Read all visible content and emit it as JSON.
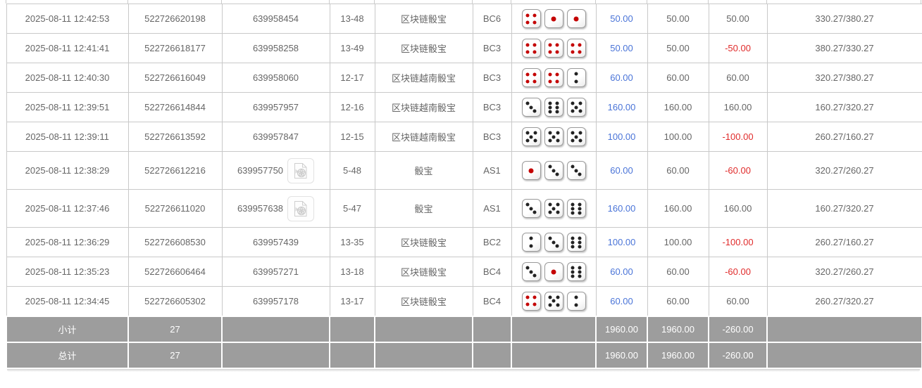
{
  "colors": {
    "accent_blue": "#4a74d8",
    "negative_red": "#e02b2b",
    "summary_bg": "#9d9d9d",
    "pip_red": "#c40000",
    "pip_black": "#222222"
  },
  "icons": {
    "video_replay": "video-replay-icon"
  },
  "table": {
    "rows": [
      {
        "time": "2025-08-11 12:42:53",
        "bet_id": "522726620198",
        "round_id": "639958454",
        "has_video": false,
        "period": "13-48",
        "game": "区块链骰宝",
        "table_code": "BC6",
        "dice": [
          4,
          1,
          1
        ],
        "bet": "50.00",
        "valid": "50.00",
        "winloss": "50.00",
        "balance": "330.27/380.27"
      },
      {
        "time": "2025-08-11 12:41:41",
        "bet_id": "522726618177",
        "round_id": "639958258",
        "has_video": false,
        "period": "13-49",
        "game": "区块链骰宝",
        "table_code": "BC3",
        "dice": [
          4,
          4,
          4
        ],
        "bet": "50.00",
        "valid": "50.00",
        "winloss": "-50.00",
        "balance": "380.27/330.27"
      },
      {
        "time": "2025-08-11 12:40:30",
        "bet_id": "522726616049",
        "round_id": "639958060",
        "has_video": false,
        "period": "12-17",
        "game": "区块链越南骰宝",
        "table_code": "BC3",
        "dice": [
          4,
          4,
          2
        ],
        "bet": "60.00",
        "valid": "60.00",
        "winloss": "60.00",
        "balance": "320.27/380.27"
      },
      {
        "time": "2025-08-11 12:39:51",
        "bet_id": "522726614844",
        "round_id": "639957957",
        "has_video": false,
        "period": "12-16",
        "game": "区块链越南骰宝",
        "table_code": "BC3",
        "dice": [
          3,
          6,
          5
        ],
        "bet": "160.00",
        "valid": "160.00",
        "winloss": "160.00",
        "balance": "160.27/320.27"
      },
      {
        "time": "2025-08-11 12:39:11",
        "bet_id": "522726613592",
        "round_id": "639957847",
        "has_video": false,
        "period": "12-15",
        "game": "区块链越南骰宝",
        "table_code": "BC3",
        "dice": [
          5,
          5,
          5
        ],
        "bet": "100.00",
        "valid": "100.00",
        "winloss": "-100.00",
        "balance": "260.27/160.27"
      },
      {
        "time": "2025-08-11 12:38:29",
        "bet_id": "522726612216",
        "round_id": "639957750",
        "has_video": true,
        "period": "5-48",
        "game": "骰宝",
        "table_code": "AS1",
        "dice": [
          1,
          3,
          3
        ],
        "bet": "60.00",
        "valid": "60.00",
        "winloss": "-60.00",
        "balance": "320.27/260.27"
      },
      {
        "time": "2025-08-11 12:37:46",
        "bet_id": "522726611020",
        "round_id": "639957638",
        "has_video": true,
        "period": "5-47",
        "game": "骰宝",
        "table_code": "AS1",
        "dice": [
          3,
          5,
          6
        ],
        "bet": "160.00",
        "valid": "160.00",
        "winloss": "160.00",
        "balance": "160.27/320.27"
      },
      {
        "time": "2025-08-11 12:36:29",
        "bet_id": "522726608530",
        "round_id": "639957439",
        "has_video": false,
        "period": "13-35",
        "game": "区块链骰宝",
        "table_code": "BC2",
        "dice": [
          2,
          3,
          6
        ],
        "bet": "100.00",
        "valid": "100.00",
        "winloss": "-100.00",
        "balance": "260.27/160.27"
      },
      {
        "time": "2025-08-11 12:35:23",
        "bet_id": "522726606464",
        "round_id": "639957271",
        "has_video": false,
        "period": "13-18",
        "game": "区块链骰宝",
        "table_code": "BC4",
        "dice": [
          3,
          1,
          6
        ],
        "bet": "60.00",
        "valid": "60.00",
        "winloss": "-60.00",
        "balance": "320.27/260.27"
      },
      {
        "time": "2025-08-11 12:34:45",
        "bet_id": "522726605302",
        "round_id": "639957178",
        "has_video": false,
        "period": "13-17",
        "game": "区块链骰宝",
        "table_code": "BC4",
        "dice": [
          4,
          5,
          2
        ],
        "bet": "60.00",
        "valid": "60.00",
        "winloss": "60.00",
        "balance": "260.27/320.27"
      }
    ],
    "summary": [
      {
        "label": "小计",
        "count": "27",
        "bet": "1960.00",
        "valid": "1960.00",
        "winloss": "-260.00"
      },
      {
        "label": "总计",
        "count": "27",
        "bet": "1960.00",
        "valid": "1960.00",
        "winloss": "-260.00"
      }
    ]
  }
}
